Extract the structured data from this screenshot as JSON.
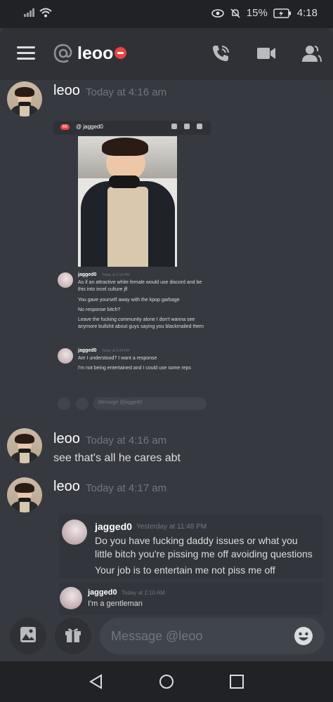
{
  "status_bar": {
    "battery": "15%",
    "time": "4:18"
  },
  "header": {
    "channel_name": "leoo",
    "icons": [
      "menu-icon",
      "at-icon",
      "dnd-status-icon",
      "voice-call-icon",
      "video-call-icon",
      "members-icon"
    ]
  },
  "messages": [
    {
      "author": "leoo",
      "time": "Today at 4:16 am",
      "embed": {
        "channel": "jagged0",
        "badge": "66",
        "composer_placeholder": "Message @jagged0",
        "messages": [
          {
            "author": "jagged0",
            "time": "Today at 9:16 PM",
            "lines": [
              "As if an attractive white female would use discord and be this into incel culture jfl",
              "You gave yourself away with the kpop garbage",
              "No response bitch?",
              "Leave the fucking community alone I don't wanna see anymore bullshit about guys saying you blackmailed them"
            ]
          },
          {
            "author": "jagged0",
            "time": "Today at 9:24 PM",
            "lines": [
              "Am I understood? I want a response",
              "I'm not being entertained and I could use some reps"
            ]
          }
        ]
      }
    },
    {
      "author": "leoo",
      "time": "Today at 4:16 am",
      "text": "see that's all he cares abt"
    },
    {
      "author": "leoo",
      "time": "Today at 4:17 am",
      "quoted": [
        {
          "author": "jagged0",
          "time": "Yesterday at 11:48 PM",
          "lines": [
            "Do you have fucking daddy issues or what you",
            "little bitch you're pissing me off avoiding questions",
            "Your job is to entertain me not piss me off"
          ]
        },
        {
          "author": "jagged0",
          "time": "Today at 2:10 AM",
          "lines": [
            "I'm a gentleman"
          ]
        }
      ]
    }
  ],
  "composer": {
    "placeholder": "Message @leoo"
  }
}
